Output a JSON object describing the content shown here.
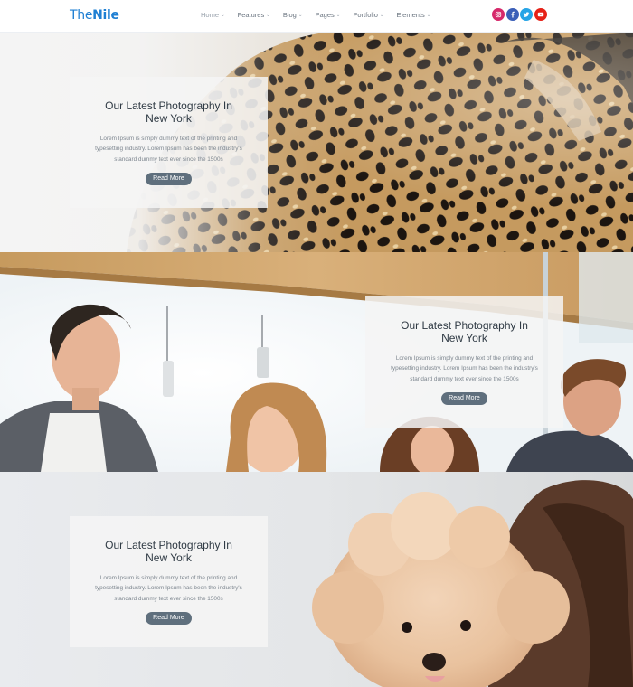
{
  "header": {
    "logo_part1": "The",
    "logo_part2": "Nile",
    "nav": [
      {
        "label": "Home"
      },
      {
        "label": "Features"
      },
      {
        "label": "Blog"
      },
      {
        "label": "Pages"
      },
      {
        "label": "Portfolio"
      },
      {
        "label": "Elements"
      }
    ],
    "socials": [
      {
        "name": "instagram",
        "color": "#d6296b"
      },
      {
        "name": "facebook",
        "color": "#3b5fb8"
      },
      {
        "name": "twitter",
        "color": "#26a4e6"
      },
      {
        "name": "youtube",
        "color": "#e62117"
      }
    ]
  },
  "slides": [
    {
      "title": "Our Latest Photography In New York",
      "text": "Lorem Ipsum is simply dummy text of the printing and typesetting industry. Lorem Ipsum has been the industry's standard dummy text ever since the 1500s",
      "button": "Read More"
    },
    {
      "title": "Our Latest Photography In New York",
      "text": "Lorem Ipsum is simply dummy text of the printing and typesetting industry. Lorem Ipsum has been the industry's standard dummy text ever since the 1500s",
      "button": "Read More"
    },
    {
      "title": "Our Latest Photography In New York",
      "text": "Lorem Ipsum is simply dummy text of the printing and typesetting industry. Lorem Ipsum has been the industry's standard dummy text ever since the 1500s",
      "button": "Read More"
    }
  ]
}
